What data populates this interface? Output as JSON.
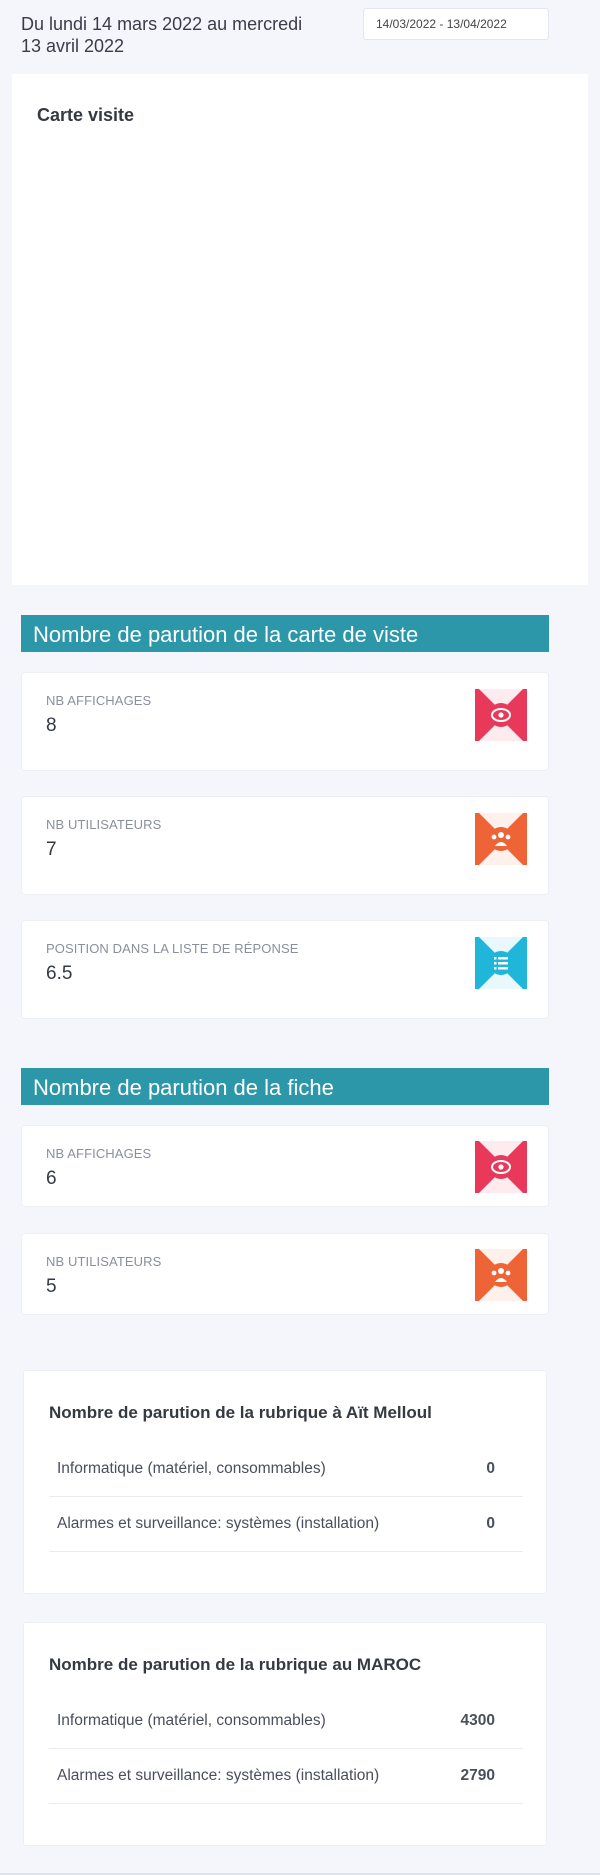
{
  "header": {
    "range_text": "Du lundi 14 mars 2022 au mercredi 13 avril 2022",
    "date_picker_value": "14/03/2022 - 13/04/2022"
  },
  "map_card": {
    "title": "Carte visite"
  },
  "section_card_visit": {
    "title": "Nombre de parution de la carte de viste",
    "stats": [
      {
        "label": "NB AFFICHAGES",
        "value": "8",
        "icon": "eye-icon",
        "color": "#e8395a"
      },
      {
        "label": "NB UTILISATEURS",
        "value": "7",
        "icon": "users-icon",
        "color": "#ee6437"
      },
      {
        "label": "POSITION DANS LA LISTE DE RÉPONSE",
        "value": "6.5",
        "icon": "list-icon",
        "color": "#1fb6d9"
      }
    ]
  },
  "section_fiche": {
    "title": "Nombre de parution de la fiche",
    "stats": [
      {
        "label": "NB AFFICHAGES",
        "value": "6",
        "icon": "eye-icon",
        "color": "#e8395a"
      },
      {
        "label": "NB UTILISATEURS",
        "value": "5",
        "icon": "users-icon",
        "color": "#ee6437"
      }
    ]
  },
  "rubrique_local": {
    "title": "Nombre de parution de la rubrique à Aït Melloul",
    "rows": [
      {
        "name": "Informatique (matériel, consommables)",
        "value": "0"
      },
      {
        "name": "Alarmes et surveillance: systèmes (installation)",
        "value": "0"
      }
    ]
  },
  "rubrique_maroc": {
    "title": "Nombre de parution de la rubrique au MAROC",
    "rows": [
      {
        "name": "Informatique (matériel, consommables)",
        "value": "4300"
      },
      {
        "name": "Alarmes et surveillance: systèmes (installation)",
        "value": "2790"
      }
    ]
  }
}
